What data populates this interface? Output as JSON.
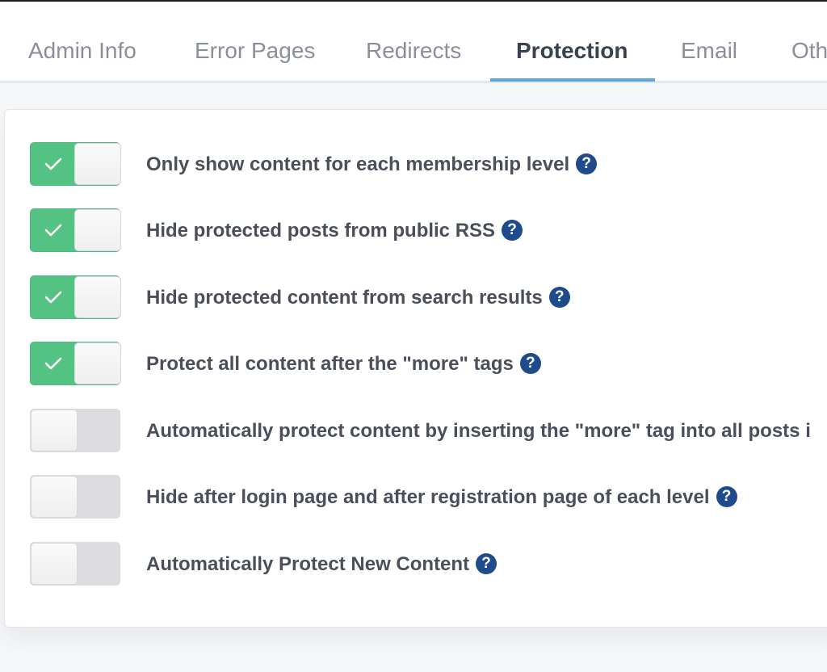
{
  "tabs": [
    {
      "label": "Admin Info"
    },
    {
      "label": "Error Pages"
    },
    {
      "label": "Redirects"
    },
    {
      "label": "Protection"
    },
    {
      "label": "Email"
    },
    {
      "label": "Oth"
    }
  ],
  "active_tab": "Protection",
  "help_icon_glyph": "?",
  "settings": [
    {
      "label": "Only show content for each membership level",
      "enabled": true,
      "has_help": true
    },
    {
      "label": "Hide protected posts from public RSS",
      "enabled": true,
      "has_help": true
    },
    {
      "label": "Hide protected content from search results",
      "enabled": true,
      "has_help": true
    },
    {
      "label": "Protect all content after the \"more\" tags",
      "enabled": true,
      "has_help": true
    },
    {
      "label": "Automatically protect content by inserting the \"more\" tag into all posts i",
      "enabled": false,
      "has_help": false
    },
    {
      "label": "Hide after login page and after registration page of each level",
      "enabled": false,
      "has_help": true
    },
    {
      "label": "Automatically Protect New Content",
      "enabled": false,
      "has_help": true
    }
  ],
  "colors": {
    "toggle_on": "#54c282",
    "toggle_off": "#dcdcde",
    "tab_accent": "#5aa6df",
    "help_icon": "#1f4a8c"
  },
  "icons": {
    "toggle_check": "check-icon",
    "help": "help-icon"
  }
}
